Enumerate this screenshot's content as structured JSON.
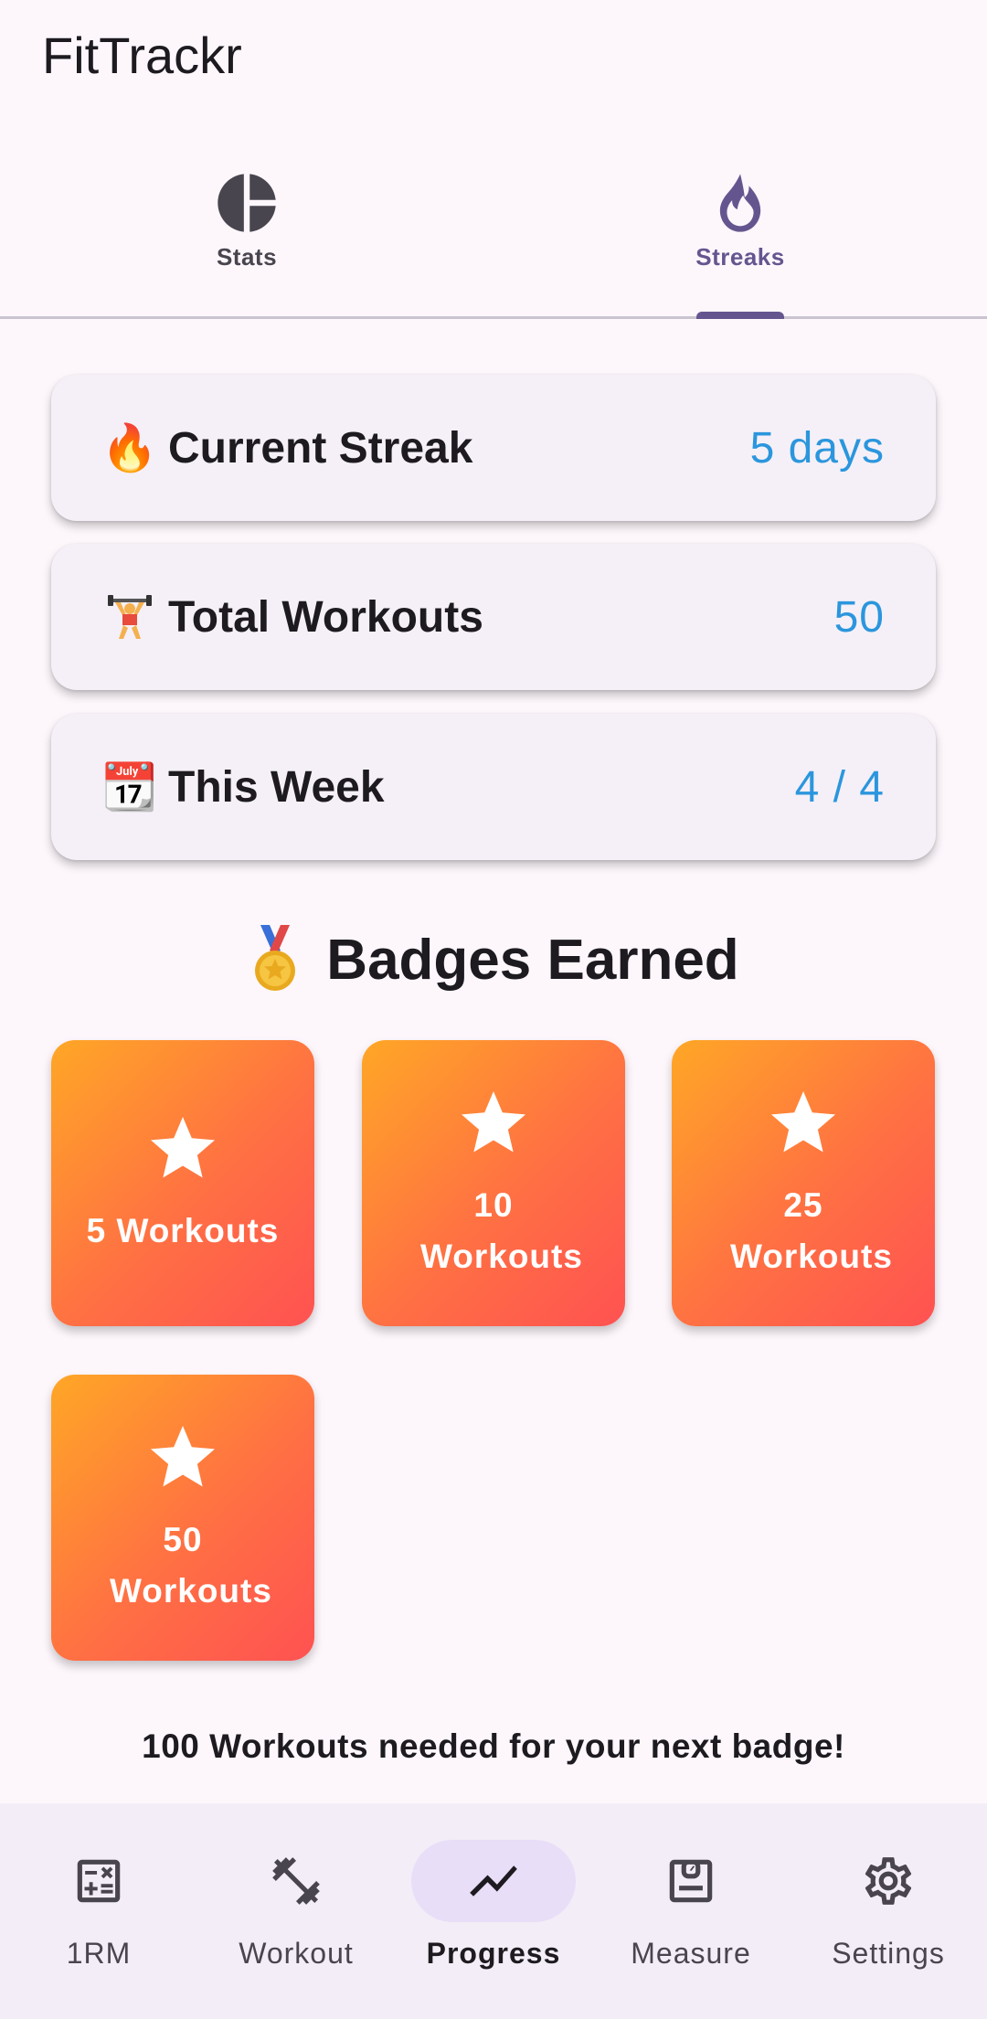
{
  "app": {
    "title": "FitTrackr"
  },
  "tabs": [
    {
      "label": "Stats",
      "icon": "pie-chart-icon",
      "active": false
    },
    {
      "label": "Streaks",
      "icon": "flame-icon",
      "active": true
    }
  ],
  "stats": [
    {
      "emoji": "🔥",
      "label": "Current Streak",
      "value": "5 days"
    },
    {
      "emoji": "🏋",
      "label": "Total Workouts",
      "value": "50"
    },
    {
      "emoji": "📆",
      "label": "This Week",
      "value": "4 / 4"
    }
  ],
  "badges_section": {
    "title": "Badges Earned",
    "badges": [
      {
        "label": "5 Workouts",
        "icon": "star-icon"
      },
      {
        "label": "10 Workouts",
        "icon": "star-icon"
      },
      {
        "label": "25 Workouts",
        "icon": "star-icon"
      },
      {
        "label": "50 Workouts",
        "icon": "star-icon"
      }
    ],
    "next_badge_text": "100 Workouts needed for your next badge!"
  },
  "bottom_nav": [
    {
      "label": "1RM",
      "icon": "calculator-icon",
      "active": false
    },
    {
      "label": "Workout",
      "icon": "dumbbell-icon",
      "active": false
    },
    {
      "label": "Progress",
      "icon": "trend-line-icon",
      "active": true
    },
    {
      "label": "Measure",
      "icon": "scale-icon",
      "active": false
    },
    {
      "label": "Settings",
      "icon": "gear-icon",
      "active": false
    }
  ],
  "colors": {
    "accent": "#65558F",
    "value_blue": "#2B96DD",
    "badge_gradient_start": "#FFA726",
    "badge_gradient_end": "#FF5252",
    "background": "#FDF7FC"
  }
}
